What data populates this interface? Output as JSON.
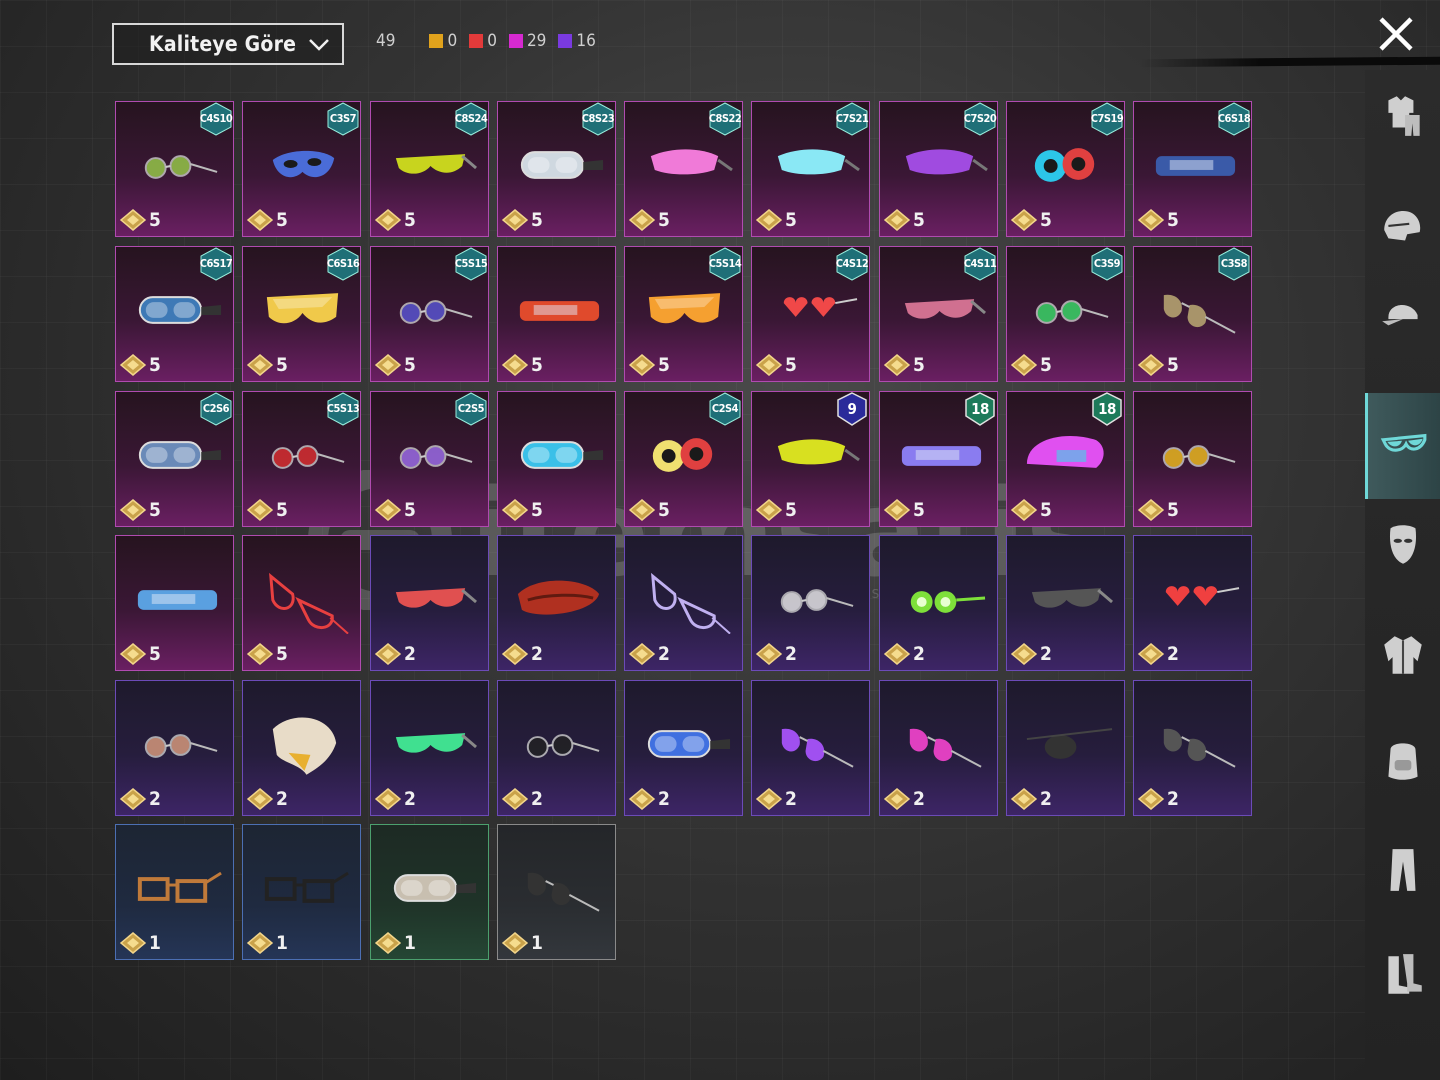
{
  "sort": {
    "label": "Kaliteye Göre"
  },
  "counts": {
    "total": "49",
    "tiers": [
      {
        "color": "#e0a21c",
        "value": "0"
      },
      {
        "color": "#e23a3a",
        "value": "0"
      },
      {
        "color": "#d62ad0",
        "value": "29"
      },
      {
        "color": "#7a3ae0",
        "value": "16"
      }
    ]
  },
  "sidebar": {
    "items": [
      {
        "icon": "outfit-icon"
      },
      {
        "icon": "helmet-icon"
      },
      {
        "icon": "cap-icon"
      },
      {
        "icon": "glasses-icon",
        "active": true
      },
      {
        "icon": "mask-icon"
      },
      {
        "icon": "jacket-icon"
      },
      {
        "icon": "backpack-icon"
      },
      {
        "icon": "pants-icon"
      },
      {
        "icon": "boots-icon"
      }
    ]
  },
  "watermark": {
    "text": "itemsatis",
    "sub": "HESAP / SATIŞ / İTEM / E-PİN",
    "domain": ".com"
  },
  "items": [
    {
      "badge": "C4S10",
      "price": "5",
      "rarity": "purple",
      "art": "round",
      "c": "#9bd14a"
    },
    {
      "badge": "C3S7",
      "price": "5",
      "rarity": "purple",
      "art": "mask",
      "c": "#4a6cd8"
    },
    {
      "badge": "C8S24",
      "price": "5",
      "rarity": "purple",
      "art": "sport",
      "c": "#c8d41e"
    },
    {
      "badge": "C8S23",
      "price": "5",
      "rarity": "purple",
      "art": "goggle",
      "c": "#cfd8e0"
    },
    {
      "badge": "C8S22",
      "price": "5",
      "rarity": "purple",
      "art": "visor",
      "c": "#f07ad8"
    },
    {
      "badge": "C7S21",
      "price": "5",
      "rarity": "purple",
      "art": "visor",
      "c": "#8ae8f5"
    },
    {
      "badge": "C7S20",
      "price": "5",
      "rarity": "purple",
      "art": "visor",
      "c": "#a04be0"
    },
    {
      "badge": "C7S19",
      "price": "5",
      "rarity": "purple",
      "art": "cyber",
      "c": "#2cc6e8"
    },
    {
      "badge": "C6S18",
      "price": "5",
      "rarity": "purple",
      "art": "band",
      "c": "#3a5aa8"
    },
    {
      "badge": "C6S17",
      "price": "5",
      "rarity": "purple",
      "art": "goggle",
      "c": "#3e79b6"
    },
    {
      "badge": "C6S16",
      "price": "5",
      "rarity": "purple",
      "art": "shield",
      "c": "#f0c94a"
    },
    {
      "badge": "C5S15",
      "price": "5",
      "rarity": "purple",
      "art": "round",
      "c": "#5a57d8"
    },
    {
      "badge": "",
      "price": "5",
      "rarity": "purple",
      "art": "band",
      "c": "#e04a2c"
    },
    {
      "badge": "C5S14",
      "price": "5",
      "rarity": "purple",
      "art": "shield",
      "c": "#f5a030"
    },
    {
      "badge": "C4S12",
      "price": "5",
      "rarity": "purple",
      "art": "heart",
      "c": "#f04848"
    },
    {
      "badge": "C4S11",
      "price": "5",
      "rarity": "purple",
      "art": "sport",
      "c": "#d07090"
    },
    {
      "badge": "C3S9",
      "price": "5",
      "rarity": "purple",
      "art": "round",
      "c": "#3ae06a"
    },
    {
      "badge": "C3S8",
      "price": "5",
      "rarity": "purple",
      "art": "aviator",
      "c": "#a8946a"
    },
    {
      "badge": "C2S6",
      "price": "5",
      "rarity": "purple",
      "art": "goggle",
      "c": "#6a8ab8"
    },
    {
      "badge": "C5S13",
      "price": "5",
      "rarity": "purple",
      "art": "round",
      "c": "#e03030"
    },
    {
      "badge": "C2S5",
      "price": "5",
      "rarity": "purple",
      "art": "round",
      "c": "#a070f0"
    },
    {
      "badge": "",
      "price": "5",
      "rarity": "purple",
      "art": "goggle",
      "c": "#3ac0e8"
    },
    {
      "badge": "C2S4",
      "price": "5",
      "rarity": "purple",
      "art": "cyber",
      "c": "#f0e070"
    },
    {
      "badge": "9",
      "price": "5",
      "rarity": "purple",
      "art": "visor",
      "c": "#d8e020",
      "num": true
    },
    {
      "badge": "18",
      "price": "5",
      "rarity": "purple",
      "art": "band",
      "c": "#8a7cf0",
      "num": true
    },
    {
      "badge": "18",
      "price": "5",
      "rarity": "purple",
      "art": "helm",
      "c": "#e050f0",
      "num": true
    },
    {
      "badge": "",
      "price": "5",
      "rarity": "purple",
      "art": "round",
      "c": "#f5c020"
    },
    {
      "badge": "",
      "price": "5",
      "rarity": "purple",
      "art": "band",
      "c": "#5aa0e0"
    },
    {
      "badge": "",
      "price": "5",
      "rarity": "purple",
      "art": "cat",
      "c": "#e84040"
    },
    {
      "badge": "",
      "price": "2",
      "rarity": "violet",
      "art": "sport",
      "c": "#e05050"
    },
    {
      "badge": "",
      "price": "2",
      "rarity": "violet",
      "art": "scarf",
      "c": "#b03020"
    },
    {
      "badge": "",
      "price": "2",
      "rarity": "violet",
      "art": "cat",
      "c": "#c0b0f0"
    },
    {
      "badge": "",
      "price": "2",
      "rarity": "violet",
      "art": "round",
      "c": "#f0f0f0"
    },
    {
      "badge": "",
      "price": "2",
      "rarity": "violet",
      "art": "lime",
      "c": "#7ee03a"
    },
    {
      "badge": "",
      "price": "2",
      "rarity": "violet",
      "art": "sport",
      "c": "#555"
    },
    {
      "badge": "",
      "price": "2",
      "rarity": "violet",
      "art": "heart",
      "c": "#f04040"
    },
    {
      "badge": "",
      "price": "2",
      "rarity": "violet",
      "art": "round",
      "c": "#e0a080"
    },
    {
      "badge": "",
      "price": "2",
      "rarity": "violet",
      "art": "eagle",
      "c": "#e8dcc8"
    },
    {
      "badge": "",
      "price": "2",
      "rarity": "violet",
      "art": "sport",
      "c": "#40e090"
    },
    {
      "badge": "",
      "price": "2",
      "rarity": "violet",
      "art": "round",
      "c": "#222"
    },
    {
      "badge": "",
      "price": "2",
      "rarity": "violet",
      "art": "goggle",
      "c": "#4070e0"
    },
    {
      "badge": "",
      "price": "2",
      "rarity": "violet",
      "art": "aviator",
      "c": "#a050f0"
    },
    {
      "badge": "",
      "price": "2",
      "rarity": "violet",
      "art": "aviator",
      "c": "#e040c0"
    },
    {
      "badge": "",
      "price": "2",
      "rarity": "violet",
      "art": "patch",
      "c": "#333"
    },
    {
      "badge": "",
      "price": "2",
      "rarity": "violet",
      "art": "aviator",
      "c": "#555"
    },
    {
      "badge": "",
      "price": "1",
      "rarity": "blue",
      "art": "rect",
      "c": "#c07a3a"
    },
    {
      "badge": "",
      "price": "1",
      "rarity": "blue",
      "art": "rect",
      "c": "#222"
    },
    {
      "badge": "",
      "price": "1",
      "rarity": "green",
      "art": "goggle",
      "c": "#c8bfb0"
    },
    {
      "badge": "",
      "price": "1",
      "rarity": "gray",
      "art": "aviator",
      "c": "#333"
    }
  ]
}
